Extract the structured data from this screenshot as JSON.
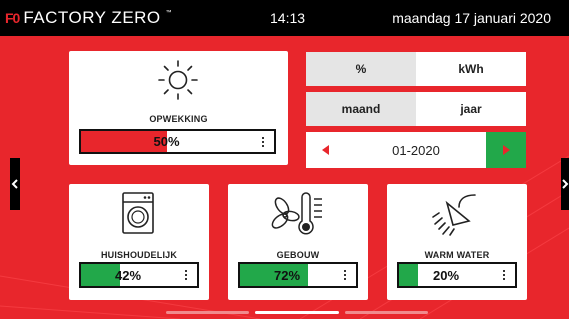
{
  "header": {
    "logo_mark": "F0",
    "brand": "FACTORY ZERO",
    "trademark": "™",
    "time": "14:13",
    "date": "maandag 17 januari 2020"
  },
  "production": {
    "label": "OPWEKKING",
    "percent": 50,
    "value_text": "50%",
    "icon": "sun-icon",
    "bar_color": "#e8262c"
  },
  "unit_toggle": {
    "options": [
      "%",
      "kWh"
    ],
    "selected": "%"
  },
  "period_toggle": {
    "options": [
      "maand",
      "jaar"
    ],
    "selected": "maand"
  },
  "period": {
    "value": "01-2020",
    "prev_icon": "triangle-left-icon",
    "next_icon": "triangle-right-icon"
  },
  "consumers": [
    {
      "label": "HUISHOUDELIJK",
      "percent": 42,
      "value_text": "42%",
      "icon": "washing-machine-icon",
      "bar_color": "#22a84a"
    },
    {
      "label": "GEBOUW",
      "percent": 72,
      "value_text": "72%",
      "icon": "fan-thermometer-icon",
      "bar_color": "#22a84a"
    },
    {
      "label": "WARM WATER",
      "percent": 20,
      "value_text": "20%",
      "icon": "shower-icon",
      "bar_color": "#22a84a"
    }
  ],
  "colors": {
    "background": "#e8262c",
    "header": "#000000",
    "accent_green": "#22a84a",
    "accent_red": "#e8262c"
  },
  "pager": {
    "pages": 3,
    "active": 1
  }
}
